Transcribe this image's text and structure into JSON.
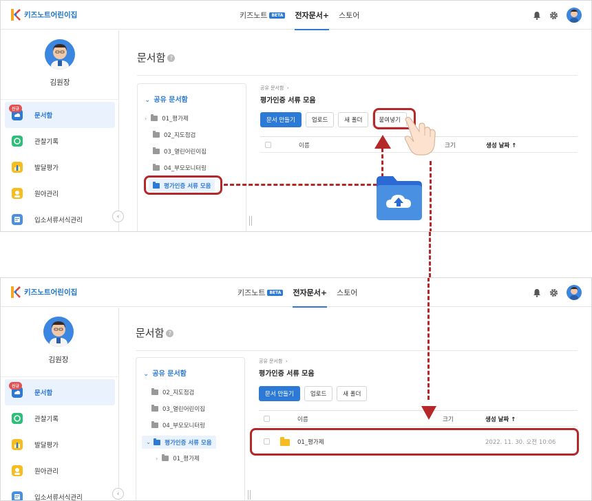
{
  "app": {
    "name": "키즈노트어린이집"
  },
  "nav": {
    "items": [
      "키즈노트",
      "전자문서+",
      "스토어"
    ],
    "beta": "BETA"
  },
  "user": {
    "name": "김원장"
  },
  "sidebar": {
    "new_badge": "신규",
    "items": [
      "문서함",
      "관찰기록",
      "발달평가",
      "원아관리",
      "입소서류서식관리"
    ]
  },
  "page": {
    "title": "문서함"
  },
  "tree": {
    "root": "공유 문서함",
    "before": [
      "01_평가제",
      "02_지도점검",
      "03_열린어린이집",
      "04_부모모니터링",
      "평가인증 서류 모음"
    ],
    "after": [
      "02_지도점검",
      "03_열린어린이집",
      "04_부모모니터링",
      "평가인증 서류 모음",
      "01_평가제"
    ]
  },
  "content": {
    "breadcrumb": "공유 문서함",
    "folder_title": "평가인증 서류 모음",
    "buttons": [
      "문서 만들기",
      "업로드",
      "새 폴더",
      "붙여넣기"
    ],
    "columns": [
      "이름",
      "크기",
      "생성 날짜"
    ],
    "sort_arrow": "↑",
    "pasted_row": {
      "name": "01_평가제",
      "date": "2022. 11. 30. 오전 10:06"
    }
  },
  "icons": {
    "bell": "bell-icon",
    "gear": "gear-icon",
    "cloud_upload": "cloud-upload-icon",
    "hand": "pointing-hand-icon"
  },
  "colors": {
    "accent": "#2d7ad6",
    "highlight": "#b5282a"
  }
}
